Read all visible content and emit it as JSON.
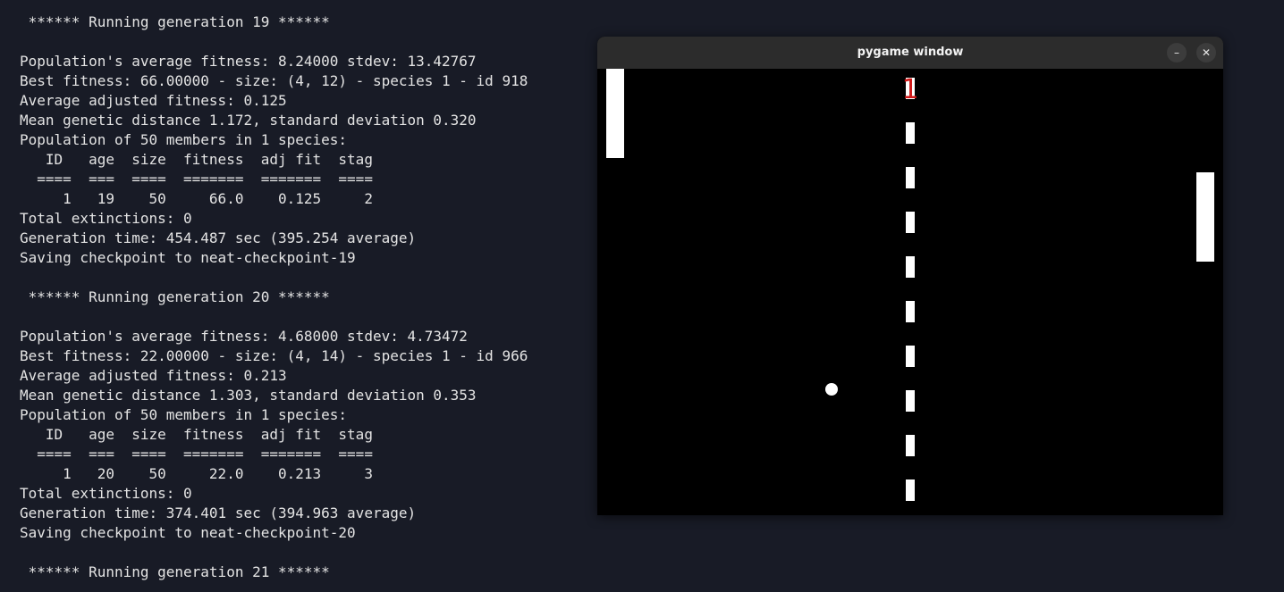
{
  "terminal": {
    "lines": [
      " ****** Running generation 19 ******",
      "",
      "Population's average fitness: 8.24000 stdev: 13.42767",
      "Best fitness: 66.00000 - size: (4, 12) - species 1 - id 918",
      "Average adjusted fitness: 0.125",
      "Mean genetic distance 1.172, standard deviation 0.320",
      "Population of 50 members in 1 species:",
      "   ID   age  size  fitness  adj fit  stag",
      "  ====  ===  ====  =======  =======  ====",
      "     1   19    50     66.0    0.125     2",
      "Total extinctions: 0",
      "Generation time: 454.487 sec (395.254 average)",
      "Saving checkpoint to neat-checkpoint-19",
      "",
      " ****** Running generation 20 ******",
      "",
      "Population's average fitness: 4.68000 stdev: 4.73472",
      "Best fitness: 22.00000 - size: (4, 14) - species 1 - id 966",
      "Average adjusted fitness: 0.213",
      "Mean genetic distance 1.303, standard deviation 0.353",
      "Population of 50 members in 1 species:",
      "   ID   age  size  fitness  adj fit  stag",
      "  ====  ===  ====  =======  =======  ====",
      "     1   20    50     22.0    0.213     3",
      "Total extinctions: 0",
      "Generation time: 374.401 sec (394.963 average)",
      "Saving checkpoint to neat-checkpoint-20",
      "",
      " ****** Running generation 21 ******"
    ]
  },
  "window": {
    "title": "pygame window",
    "minimize_icon": "–",
    "close_icon": "✕"
  },
  "game": {
    "score": "1"
  },
  "colors": {
    "terminal_bg": "#181b26",
    "terminal_text": "#e4e4e4",
    "titlebar_bg": "#2c2c2c",
    "game_bg": "#000000",
    "score_color": "#d01818"
  }
}
